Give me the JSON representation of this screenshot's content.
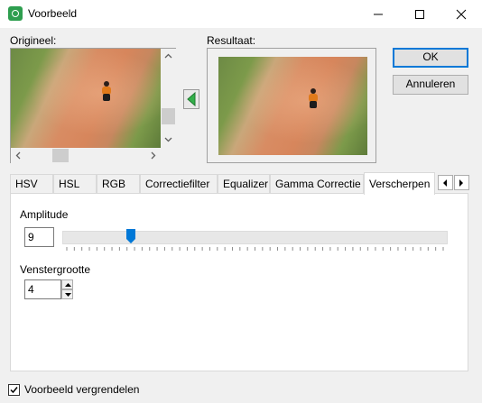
{
  "window": {
    "title": "Voorbeeld",
    "icon": "preview-app-icon",
    "controls": [
      "minimize-icon",
      "maximize-icon",
      "close-icon"
    ]
  },
  "preview": {
    "original_label": "Origineel:",
    "result_label": "Resultaat:",
    "copy_arrow_icon": "left-arrow-icon"
  },
  "buttons": {
    "ok": "OK",
    "cancel": "Annuleren"
  },
  "tabs": [
    {
      "label": "HSV"
    },
    {
      "label": "HSL"
    },
    {
      "label": "RGB"
    },
    {
      "label": "Correctiefilter"
    },
    {
      "label": "Equalizer"
    },
    {
      "label": "Gamma Correctie"
    },
    {
      "label": "Verscherpen",
      "active": true
    }
  ],
  "sharpen": {
    "amplitude_label": "Amplitude",
    "amplitude_value": "9",
    "amplitude_slider_fraction": 0.17,
    "window_size_label": "Venstergrootte",
    "window_size_value": "4"
  },
  "footer": {
    "lock_preview_label": "Voorbeeld vergrendelen",
    "lock_preview_checked": true
  },
  "colors": {
    "accent": "#0078d7",
    "slider_thumb": "#0078d7",
    "arrow_green": "#33b04a"
  }
}
